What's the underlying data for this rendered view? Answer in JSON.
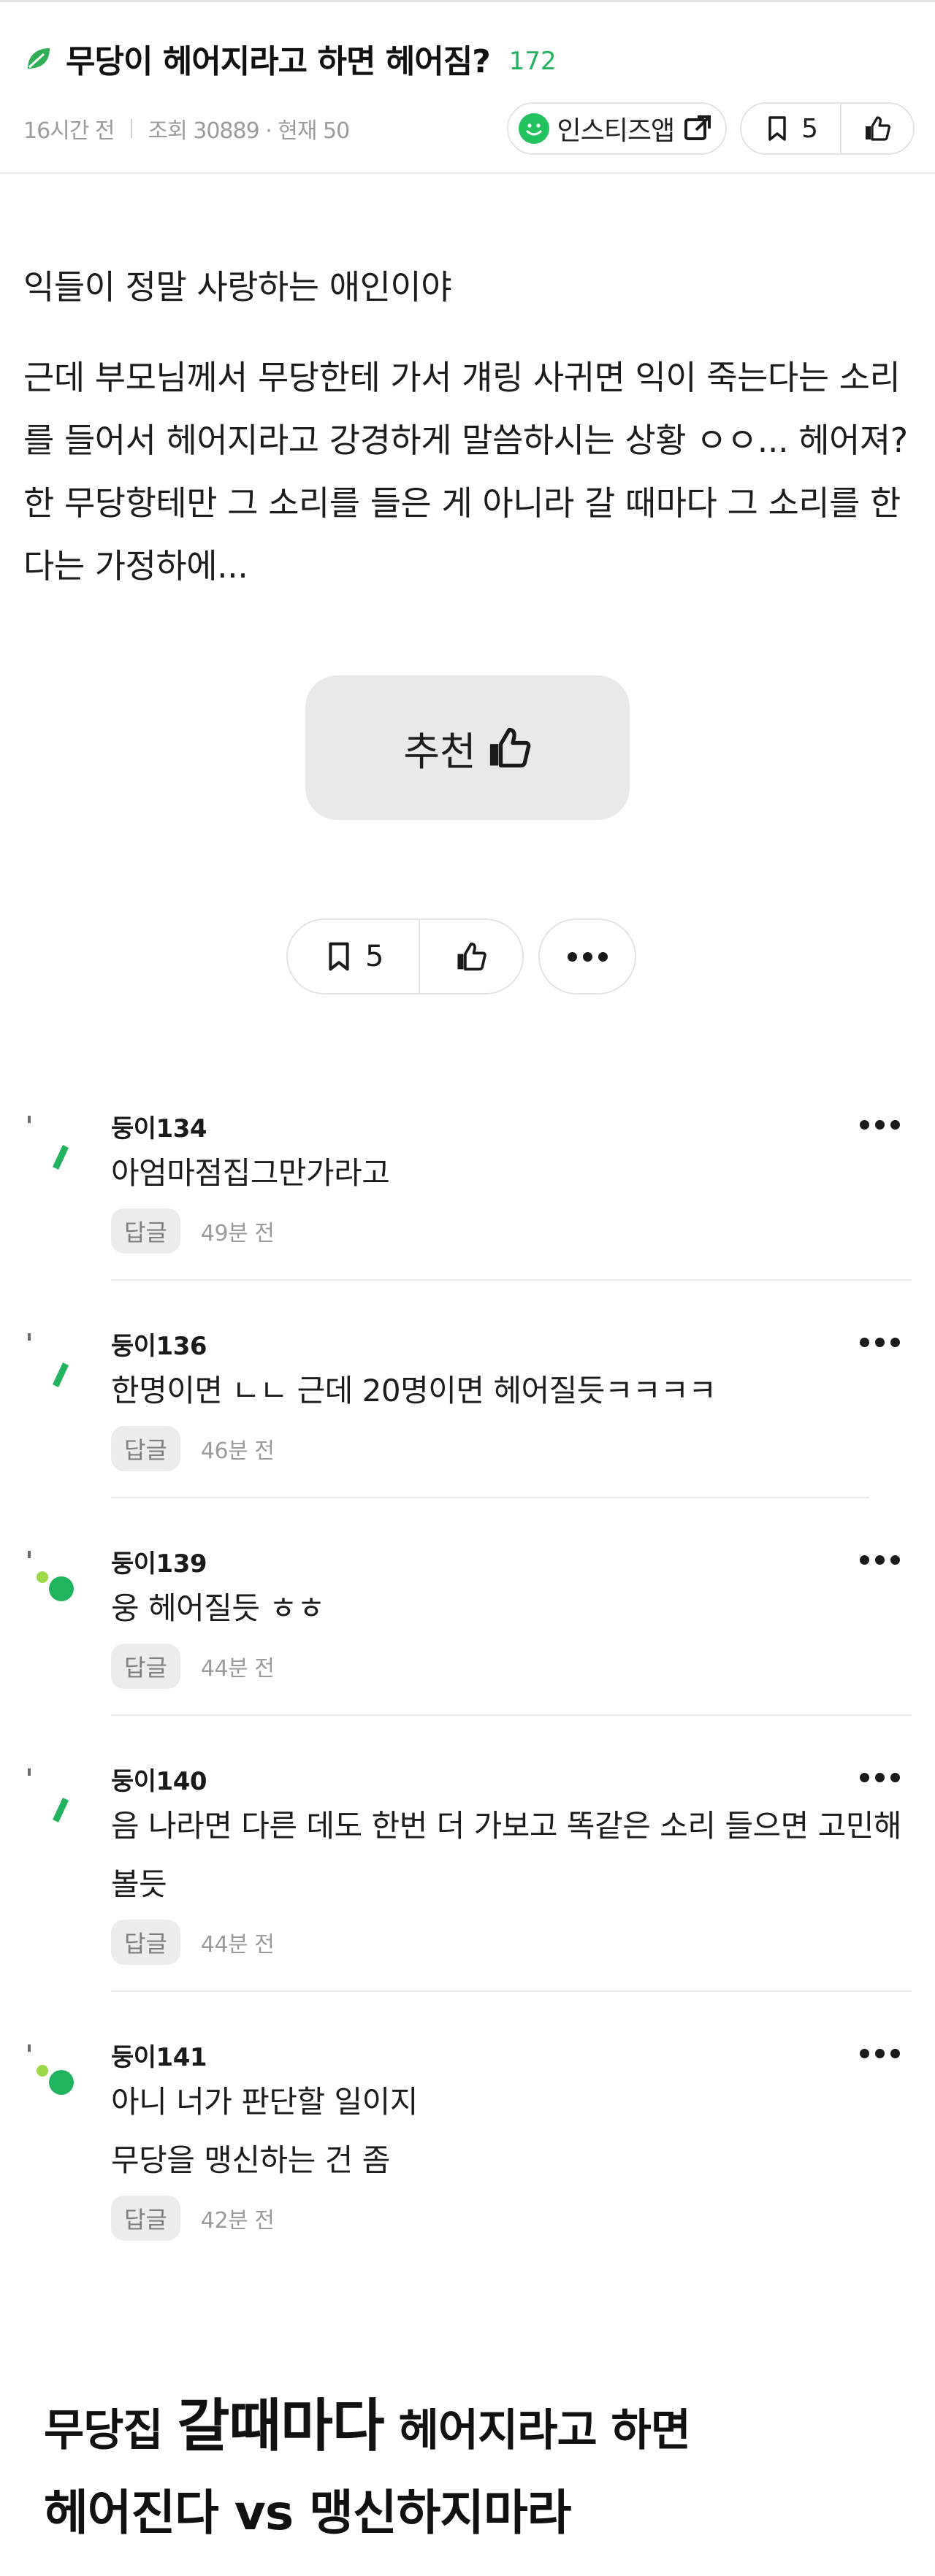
{
  "post": {
    "title": "무당이 헤어지라고 하면 헤어짐?",
    "comment_count": "172",
    "time_ago": "16시간 전",
    "views": "조회 30889 · 현재 50",
    "app_button": "인스티즈앱",
    "bookmark_count": "5"
  },
  "body": {
    "paragraph1": "익들이 정말 사랑하는 애인이야",
    "paragraph2": "근데 부모님께서 무당한테 가서 걔링 사귀면 익이 죽는다는 소리를 들어서 헤어지라고 강경하게 말씀하시는 상황 ㅇㅇ... 헤어져? 한 무당항테만 그 소리를 들은 게 아니라 갈 때마다 그 소리를 한다는 가정하에..."
  },
  "recommend_button": "추천",
  "bottom_actions": {
    "bookmark_count": "5"
  },
  "comments": [
    {
      "name": "둥이134",
      "text": "아엄마점집그만가라고",
      "reply": "답글",
      "time": "49분 전",
      "avatar": "leaf-icon"
    },
    {
      "name": "둥이136",
      "text": "한명이면 ㄴㄴ 근데 20명이면 헤어질듯ㅋㅋㅋㅋ",
      "reply": "답글",
      "time": "46분 전",
      "avatar": "leaf-icon"
    },
    {
      "name": "둥이139",
      "text": "웅 헤어질듯 ㅎㅎ",
      "reply": "답글",
      "time": "44분 전",
      "avatar": "sprout-icon"
    },
    {
      "name": "둥이140",
      "text": "음 나라면 다른 데도 한번 더 가보고 똑같은 소리 들으면 고민해볼듯",
      "reply": "답글",
      "time": "44분 전",
      "avatar": "leaf-icon"
    },
    {
      "name": "둥이141",
      "text": "아니 너가 판단할 일이지\n무당을 맹신하는 건 좀",
      "reply": "답글",
      "time": "42분 전",
      "avatar": "sprout-icon"
    }
  ],
  "caption": {
    "part1": "무당집",
    "part2": "갈때마다",
    "part3": "헤어지라고 하면",
    "line2": "헤어진다 vs 맹신하지마라"
  },
  "colors": {
    "accent_green": "#22b35e",
    "pill_border": "#e4e4e4",
    "recommend_bg": "#e9e9e9"
  }
}
